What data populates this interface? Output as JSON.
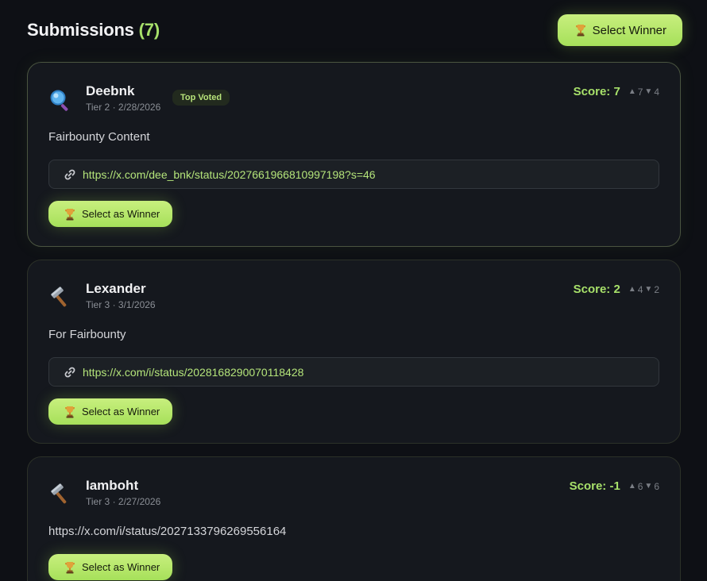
{
  "header": {
    "title": "Submissions",
    "count": "(7)",
    "select_winner_label": "Select Winner"
  },
  "colors": {
    "accent": "#a7e06a",
    "button": "#b7e86c",
    "background": "#0e1015",
    "card": "#15181e"
  },
  "submissions": [
    {
      "avatar_icon": "magnifying-glass-icon",
      "username": "Deebnk",
      "meta": "Tier 2 · 2/28/2026",
      "badge": "Top Voted",
      "score": "Score: 7",
      "upvotes": "7",
      "downvotes": "4",
      "description": "Fairbounty Content",
      "link": "https://x.com/dee_bnk/status/2027661966810997198?s=46",
      "button_label": "Select as Winner"
    },
    {
      "avatar_icon": "hammer-icon",
      "username": "Lexander",
      "meta": "Tier 3 · 3/1/2026",
      "score": "Score: 2",
      "upvotes": "4",
      "downvotes": "2",
      "description": "For Fairbounty",
      "link": "https://x.com/i/status/2028168290070118428",
      "button_label": "Select as Winner"
    },
    {
      "avatar_icon": "hammer-icon",
      "username": "Iamboht",
      "meta": "Tier 3 · 2/27/2026",
      "score": "Score: -1",
      "upvotes": "6",
      "downvotes": "6",
      "description": "https://x.com/i/status/2027133796269556164",
      "button_label": "Select as Winner"
    }
  ]
}
